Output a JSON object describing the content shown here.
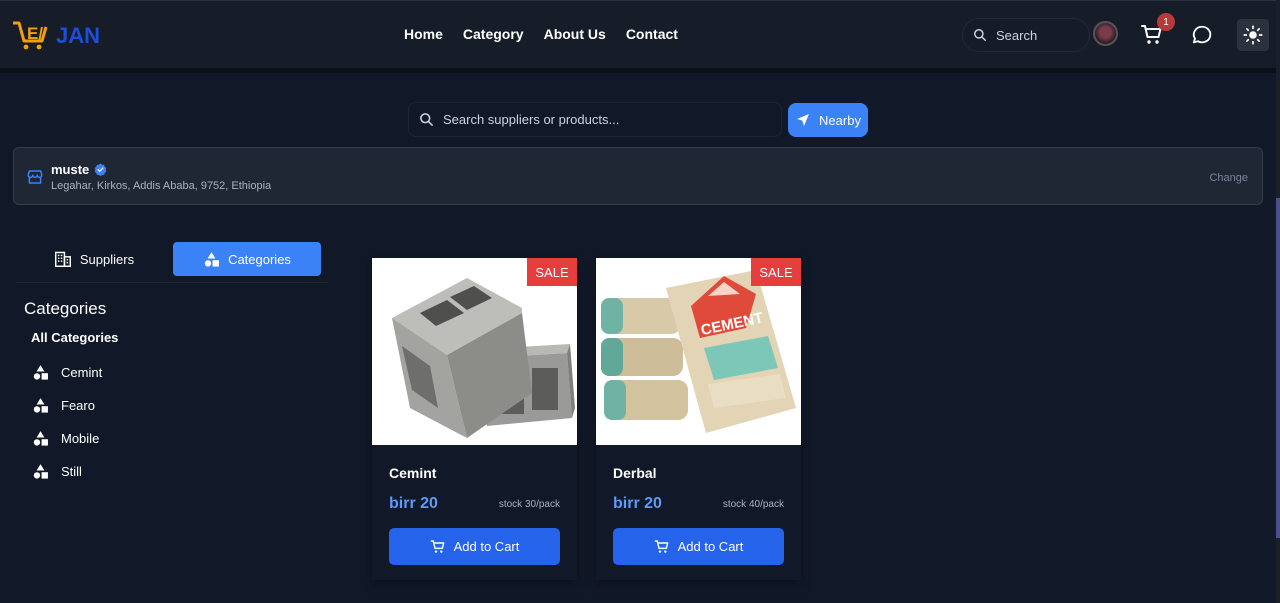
{
  "brand": {
    "logo_text": "JEJAN"
  },
  "nav": {
    "links": [
      "Home",
      "Category",
      "About Us",
      "Contact"
    ],
    "search_placeholder": "Search",
    "cart_count": "1"
  },
  "search": {
    "placeholder": "Search suppliers or products...",
    "nearby_label": "Nearby"
  },
  "location": {
    "name": "muste",
    "address": "Legahar, Kirkos, Addis Ababa, 9752, Ethiopia",
    "change_label": "Change"
  },
  "tabs": {
    "suppliers": "Suppliers",
    "categories": "Categories",
    "active": "categories"
  },
  "sidebar": {
    "title": "Categories",
    "all_label": "All Categories",
    "items": [
      "Cemint",
      "Fearo",
      "Mobile",
      "Still"
    ]
  },
  "products": [
    {
      "name": "Cemint",
      "price": "birr 20",
      "stock": "stock 30/pack",
      "badge": "SALE",
      "button": "Add to Cart",
      "image": "concrete-blocks"
    },
    {
      "name": "Derbal",
      "price": "birr 20",
      "stock": "stock 40/pack",
      "badge": "SALE",
      "button": "Add to Cart",
      "image": "cement-bags"
    }
  ],
  "colors": {
    "accent": "#3b82f6",
    "sale": "#e53e3e",
    "price": "#5b9af8",
    "background": "#111827"
  }
}
